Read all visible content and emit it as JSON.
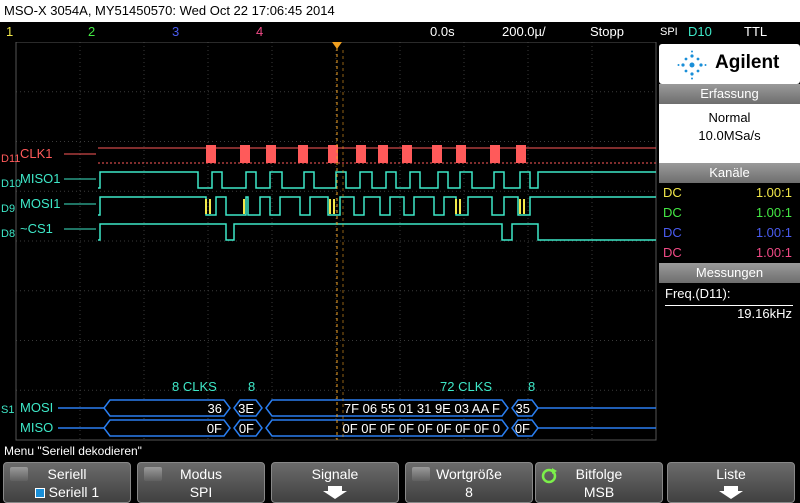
{
  "title": "MSO-X 3054A, MY51450570: Wed Oct 22 17:06:45 2014",
  "status": {
    "ch1": "1",
    "ch2": "2",
    "ch3": "3",
    "ch4": "4",
    "time_offset": "0.0s",
    "timebase": "200.0µ/",
    "run_state": "Stopp",
    "trigger_type": "SPI",
    "trigger_source": "D10",
    "trigger_level": "TTL"
  },
  "colors": {
    "ch1": "#f2e84a",
    "ch2": "#44e844",
    "ch3": "#4a5cf0",
    "ch4": "#f04a86",
    "digital_clk": "#ff5a5a",
    "digital": "#3ee8c8",
    "serial": "#2a7ef0",
    "trigger_marker": "#f0a020",
    "grid": "#3a3a3a"
  },
  "digital_labels": [
    {
      "ch": "D11",
      "name": "CLK1"
    },
    {
      "ch": "D10",
      "name": "MISO1"
    },
    {
      "ch": "D9",
      "name": "MOSI1"
    },
    {
      "ch": "D8",
      "name": "~CS1"
    }
  ],
  "serial": {
    "bus_label": "S1",
    "row1_label": "MOSI",
    "row2_label": "MISO",
    "annotation_left_clks": "8 CLKS",
    "annotation_left_n": "8",
    "annotation_right_clks": "72 CLKS",
    "annotation_right_n": "8",
    "mosi_packets": [
      "36",
      "3E",
      "7F 06 55 01 31 9E 03 AA F",
      "35"
    ],
    "miso_packets": [
      "0F",
      "0F",
      "0F 0F 0F 0F 0F 0F 0F 0F 0",
      "0F"
    ]
  },
  "right_panel": {
    "brand": "Agilent",
    "acq_header": "Erfassung",
    "acq_mode": "Normal",
    "acq_rate": "10.0MSa/s",
    "channels_header": "Kanäle",
    "channels": [
      {
        "coupling": "DC",
        "ratio": "1.00:1"
      },
      {
        "coupling": "DC",
        "ratio": "1.00:1"
      },
      {
        "coupling": "DC",
        "ratio": "1.00:1"
      },
      {
        "coupling": "DC",
        "ratio": "1.00:1"
      }
    ],
    "meas_header": "Messungen",
    "meas_label": "Freq.(D11):",
    "meas_value": "19.16kHz"
  },
  "menu": {
    "title": "Menu \"Seriell dekodieren\"",
    "softkeys": [
      {
        "title": "Seriell",
        "value": "Seriell 1"
      },
      {
        "title": "Modus",
        "value": "SPI"
      },
      {
        "title": "Signale",
        "value": ""
      },
      {
        "title": "Wortgröße",
        "value": "8"
      },
      {
        "title": "Bitfolge",
        "value": "MSB"
      },
      {
        "title": "Liste",
        "value": ""
      }
    ]
  }
}
